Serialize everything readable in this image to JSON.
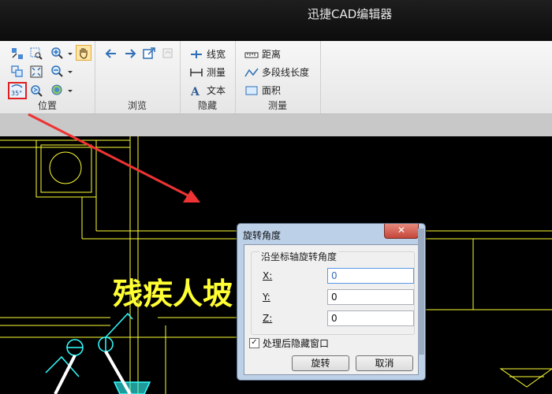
{
  "app": {
    "title": "迅捷CAD编辑器"
  },
  "ribbon": {
    "groups": {
      "position": {
        "label": "位置"
      },
      "browse": {
        "label": "浏览"
      },
      "hide": {
        "label": "隐藏",
        "items": [
          "线宽",
          "测量",
          "文本"
        ]
      },
      "measure": {
        "label": "测量",
        "items": [
          "距离",
          "多段线长度",
          "面积"
        ]
      }
    },
    "rotate_icon_text": "35°"
  },
  "drawing": {
    "text": "残疾人坡"
  },
  "dialog": {
    "title": "旋转角度",
    "close_label": "✕",
    "group_label": "沿坐标轴旋转角度",
    "fields": [
      {
        "label": "X:",
        "value": "0"
      },
      {
        "label": "Y:",
        "value": "0"
      },
      {
        "label": "Z:",
        "value": "0"
      }
    ],
    "checkbox_label": "处理后隐藏窗口",
    "checkbox_checked": "✓",
    "ok_label": "旋转",
    "cancel_label": "取消"
  },
  "colors": {
    "cad_yellow": "#ffff33",
    "cad_cyan": "#33ffff",
    "arrow_red": "#ee3333",
    "highlight_red": "#e02020"
  }
}
